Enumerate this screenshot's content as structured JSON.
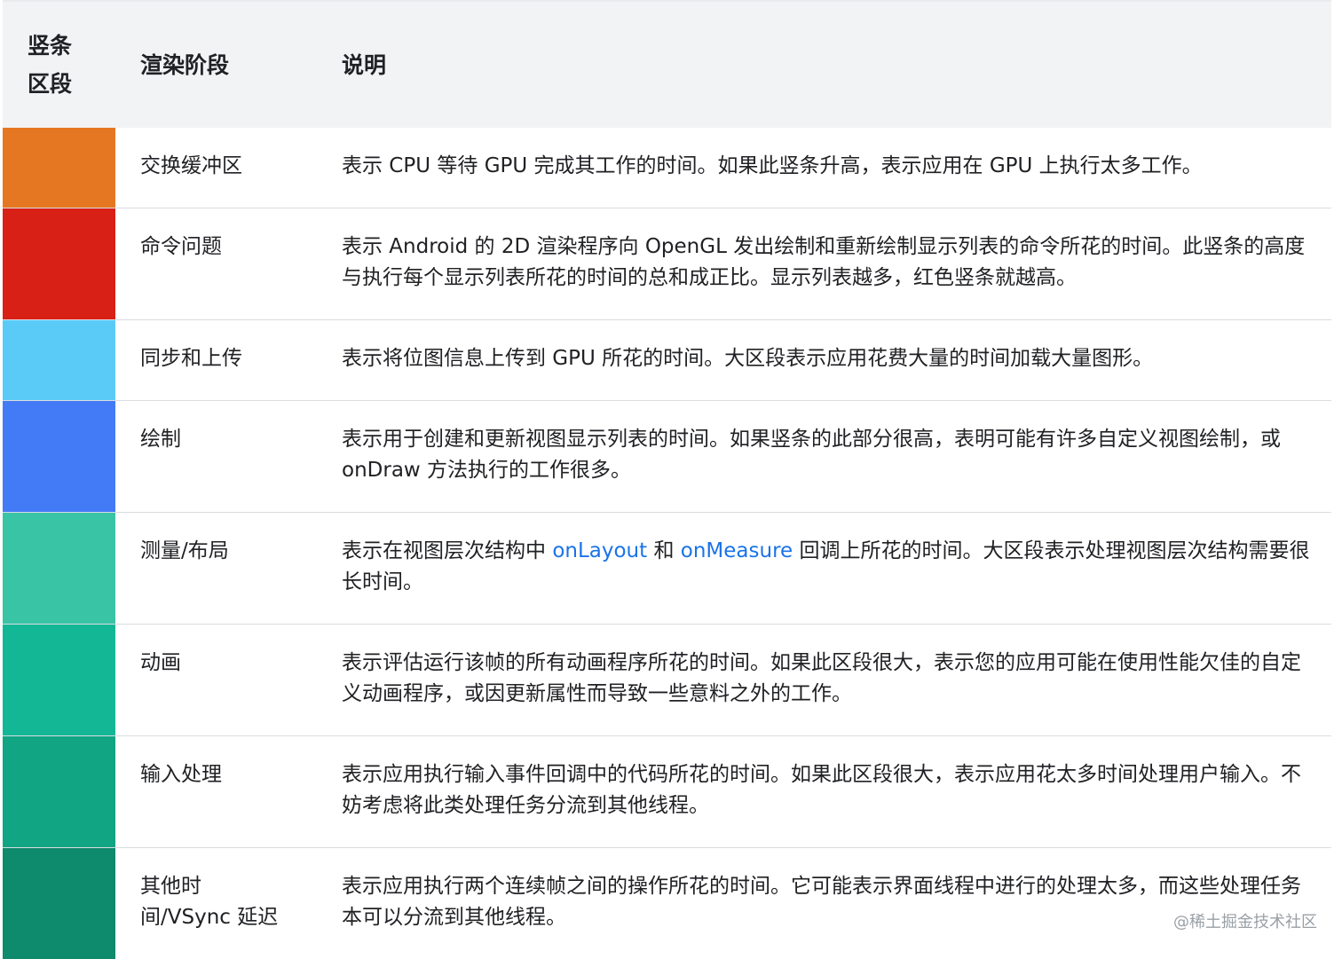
{
  "header": {
    "col1": "竖条\n区段",
    "col1_line1": "竖条",
    "col1_line2": "区段",
    "col2": "渲染阶段",
    "col3": "说明"
  },
  "rows": [
    {
      "color": "#e67722",
      "stage": "交换缓冲区",
      "desc": "表示 CPU 等待 GPU 完成其工作的时间。如果此竖条升高，表示应用在 GPU 上执行太多工作。"
    },
    {
      "color": "#d82017",
      "stage": "命令问题",
      "desc": "表示 Android 的 2D 渲染程序向 OpenGL 发出绘制和重新绘制显示列表的命令所花的时间。此竖条的高度与执行每个显示列表所花的时间的总和成正比。显示列表越多，红色竖条就越高。"
    },
    {
      "color": "#5acbf7",
      "stage": "同步和上传",
      "desc": "表示将位图信息上传到 GPU 所花的时间。大区段表示应用花费大量的时间加载大量图形。"
    },
    {
      "color": "#437bf6",
      "stage": "绘制",
      "desc": "表示用于创建和更新视图显示列表的时间。如果竖条的此部分很高，表明可能有许多自定义视图绘制，或 onDraw 方法执行的工作很多。"
    },
    {
      "color": "#3ac4a6",
      "stage": "测量/布局",
      "desc_pre": "表示在视图层次结构中 ",
      "link1": "onLayout",
      "desc_mid": " 和 ",
      "link2": "onMeasure",
      "desc_post": " 回调上所花的时间。大区段表示处理视图层次结构需要很长时间。"
    },
    {
      "color": "#13b796",
      "stage": "动画",
      "desc": "表示评估运行该帧的所有动画程序所花的时间。如果此区段很大，表示您的应用可能在使用性能欠佳的自定义动画程序，或因更新属性而导致一些意料之外的工作。"
    },
    {
      "color": "#11a584",
      "stage": "输入处理",
      "desc": "表示应用执行输入事件回调中的代码所花的时间。如果此区段很大，表示应用花太多时间处理用户输入。不妨考虑将此类处理任务分流到其他线程。"
    },
    {
      "color": "#0e8a6c",
      "stage_line1": "其他时",
      "stage_line2": "间/VSync 延迟",
      "desc": "表示应用执行两个连续帧之间的操作所花的时间。它可能表示界面线程中进行的处理太多，而这些处理任务本可以分流到其他线程。"
    }
  ],
  "watermark": "@稀土掘金技术社区"
}
